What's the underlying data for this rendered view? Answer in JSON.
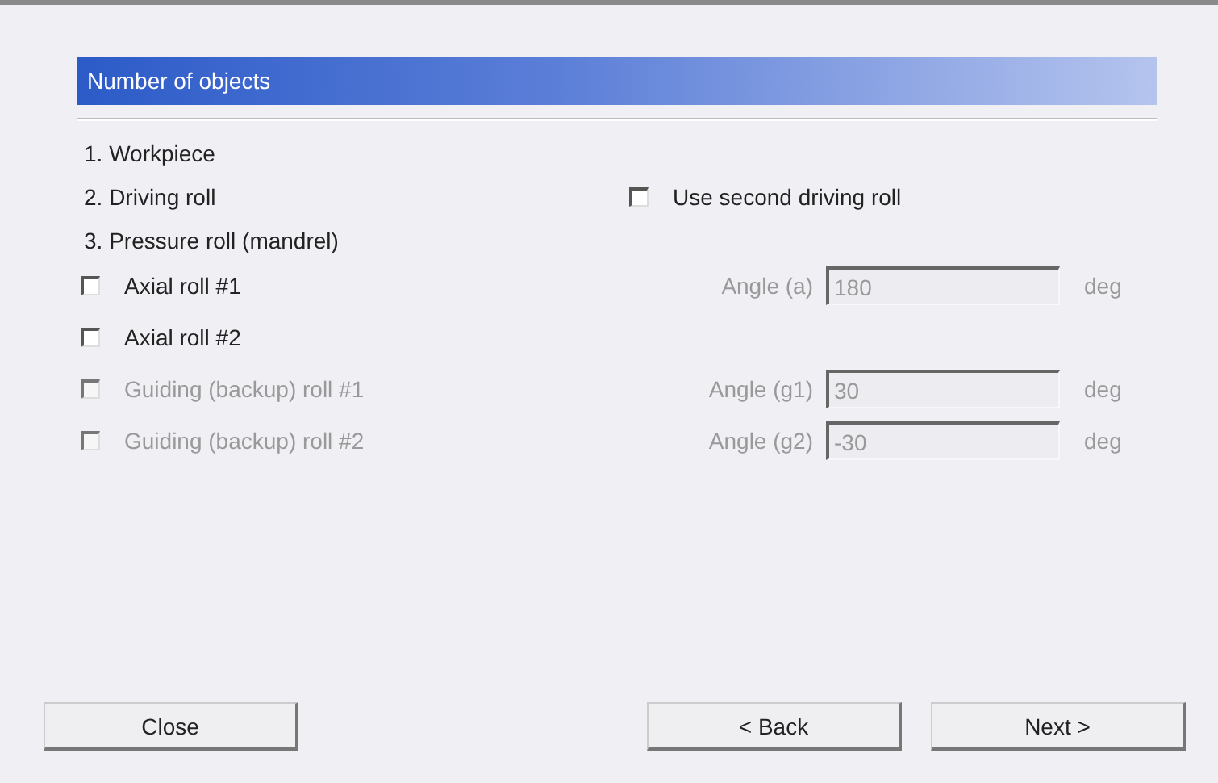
{
  "header": {
    "title": "Number of objects"
  },
  "objects": [
    {
      "label": "1. Workpiece"
    },
    {
      "label": "2. Driving roll",
      "option": {
        "label": "Use second driving roll",
        "checked": false,
        "disabled": false
      }
    },
    {
      "label": "3. Pressure roll (mandrel)"
    }
  ],
  "rolls": [
    {
      "label": "Axial roll #1",
      "checked": false,
      "disabled": false,
      "angle": {
        "label": "Angle (a)",
        "value": "180",
        "unit": "deg",
        "disabled": true
      }
    },
    {
      "label": "Axial roll #2",
      "checked": false,
      "disabled": false
    },
    {
      "label": "Guiding (backup) roll #1",
      "checked": false,
      "disabled": true,
      "angle": {
        "label": "Angle (g1)",
        "value": "30",
        "unit": "deg",
        "disabled": true
      }
    },
    {
      "label": "Guiding (backup) roll #2",
      "checked": false,
      "disabled": true,
      "angle": {
        "label": "Angle (g2)",
        "value": "-30",
        "unit": "deg",
        "disabled": true
      }
    }
  ],
  "buttons": [
    {
      "label": "Close",
      "kind": "left"
    },
    {
      "label": "< Back",
      "kind": "right"
    },
    {
      "label": "Next >",
      "kind": "right"
    }
  ]
}
